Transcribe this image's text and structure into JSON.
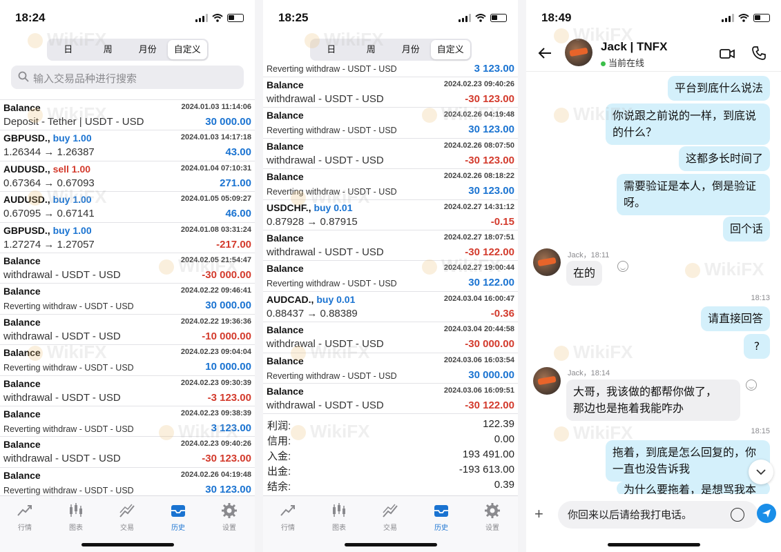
{
  "watermark": "WikiFX",
  "accent": "#1a73d1",
  "negative_color": "#d33a2c",
  "left": {
    "time": "18:24",
    "segments": [
      "日",
      "周",
      "月份",
      "自定义"
    ],
    "active_segment": "自定义",
    "search_placeholder": "输入交易品种进行搜索",
    "rows": [
      {
        "sym": "Balance",
        "side": "",
        "side_type": "",
        "dt": "2024.01.03 11:14:06",
        "cmt": "Deposit - Tether | USDT - USD",
        "small": false,
        "amt": "30 000.00",
        "sign": "pos"
      },
      {
        "sym": "GBPUSD.,",
        "side": "buy 1.00",
        "side_type": "buy",
        "dt": "2024.01.03 14:17:18",
        "cmt": "1.26344 → 1.26387",
        "small": false,
        "amt": "43.00",
        "sign": "pos"
      },
      {
        "sym": "AUDUSD.,",
        "side": "sell 1.00",
        "side_type": "sell",
        "dt": "2024.01.04 07:10:31",
        "cmt": "0.67364 → 0.67093",
        "small": false,
        "amt": "271.00",
        "sign": "pos"
      },
      {
        "sym": "AUDUSD.,",
        "side": "buy 1.00",
        "side_type": "buy",
        "dt": "2024.01.05 05:09:27",
        "cmt": "0.67095 → 0.67141",
        "small": false,
        "amt": "46.00",
        "sign": "pos"
      },
      {
        "sym": "GBPUSD.,",
        "side": "buy 1.00",
        "side_type": "buy",
        "dt": "2024.01.08 03:31:24",
        "cmt": "1.27274 → 1.27057",
        "small": false,
        "amt": "-217.00",
        "sign": "neg"
      },
      {
        "sym": "Balance",
        "side": "",
        "side_type": "",
        "dt": "2024.02.05 21:54:47",
        "cmt": "withdrawal - USDT - USD",
        "small": false,
        "amt": "-30 000.00",
        "sign": "neg"
      },
      {
        "sym": "Balance",
        "side": "",
        "side_type": "",
        "dt": "2024.02.22 09:46:41",
        "cmt": "Reverting withdraw - USDT - USD",
        "small": true,
        "amt": "30 000.00",
        "sign": "pos"
      },
      {
        "sym": "Balance",
        "side": "",
        "side_type": "",
        "dt": "2024.02.22 19:36:36",
        "cmt": "withdrawal - USDT - USD",
        "small": false,
        "amt": "-10 000.00",
        "sign": "neg"
      },
      {
        "sym": "Balance",
        "side": "",
        "side_type": "",
        "dt": "2024.02.23 09:04:04",
        "cmt": "Reverting withdraw - USDT - USD",
        "small": true,
        "amt": "10 000.00",
        "sign": "pos"
      },
      {
        "sym": "Balance",
        "side": "",
        "side_type": "",
        "dt": "2024.02.23 09:30:39",
        "cmt": "withdrawal - USDT - USD",
        "small": false,
        "amt": "-3 123.00",
        "sign": "neg"
      },
      {
        "sym": "Balance",
        "side": "",
        "side_type": "",
        "dt": "2024.02.23 09:38:39",
        "cmt": "Reverting withdraw - USDT - USD",
        "small": true,
        "amt": "3 123.00",
        "sign": "pos"
      },
      {
        "sym": "Balance",
        "side": "",
        "side_type": "",
        "dt": "2024.02.23 09:40:26",
        "cmt": "withdrawal - USDT - USD",
        "small": false,
        "amt": "-30 123.00",
        "sign": "neg"
      },
      {
        "sym": "Balance",
        "side": "",
        "side_type": "",
        "dt": "2024.02.26 04:19:48",
        "cmt": "Reverting withdraw - USDT - USD",
        "small": true,
        "amt": "30 123.00",
        "sign": "pos"
      }
    ],
    "tabs": [
      {
        "label": "行情",
        "icon": "quotes-icon"
      },
      {
        "label": "图表",
        "icon": "chart-icon"
      },
      {
        "label": "交易",
        "icon": "trade-icon"
      },
      {
        "label": "历史",
        "icon": "history-icon"
      },
      {
        "label": "设置",
        "icon": "settings-icon"
      }
    ],
    "active_tab": "历史"
  },
  "middle": {
    "time": "18:25",
    "segments": [
      "日",
      "周",
      "月份",
      "自定义"
    ],
    "active_segment": "自定义",
    "top_partial": {
      "cmt": "Reverting withdraw - USDT - USD",
      "amt": "3 123.00"
    },
    "rows": [
      {
        "sym": "Balance",
        "side": "",
        "side_type": "",
        "dt": "2024.02.23 09:40:26",
        "cmt": "withdrawal - USDT - USD",
        "small": false,
        "amt": "-30 123.00",
        "sign": "neg"
      },
      {
        "sym": "Balance",
        "side": "",
        "side_type": "",
        "dt": "2024.02.26 04:19:48",
        "cmt": "Reverting withdraw - USDT - USD",
        "small": true,
        "amt": "30 123.00",
        "sign": "pos"
      },
      {
        "sym": "Balance",
        "side": "",
        "side_type": "",
        "dt": "2024.02.26 08:07:50",
        "cmt": "withdrawal - USDT - USD",
        "small": false,
        "amt": "-30 123.00",
        "sign": "neg"
      },
      {
        "sym": "Balance",
        "side": "",
        "side_type": "",
        "dt": "2024.02.26 08:18:22",
        "cmt": "Reverting withdraw - USDT - USD",
        "small": true,
        "amt": "30 123.00",
        "sign": "pos"
      },
      {
        "sym": "USDCHF.,",
        "side": "buy 0.01",
        "side_type": "buy",
        "dt": "2024.02.27 14:31:12",
        "cmt": "0.87928 → 0.87915",
        "small": false,
        "amt": "-0.15",
        "sign": "neg"
      },
      {
        "sym": "Balance",
        "side": "",
        "side_type": "",
        "dt": "2024.02.27 18:07:51",
        "cmt": "withdrawal - USDT - USD",
        "small": false,
        "amt": "-30 122.00",
        "sign": "neg"
      },
      {
        "sym": "Balance",
        "side": "",
        "side_type": "",
        "dt": "2024.02.27 19:00:44",
        "cmt": "Reverting withdraw - USDT - USD",
        "small": true,
        "amt": "30 122.00",
        "sign": "pos"
      },
      {
        "sym": "AUDCAD.,",
        "side": "buy 0.01",
        "side_type": "buy",
        "dt": "2024.03.04 16:00:47",
        "cmt": "0.88437 → 0.88389",
        "small": false,
        "amt": "-0.36",
        "sign": "neg"
      },
      {
        "sym": "Balance",
        "side": "",
        "side_type": "",
        "dt": "2024.03.04 20:44:58",
        "cmt": "withdrawal - USDT - USD",
        "small": false,
        "amt": "-30 000.00",
        "sign": "neg"
      },
      {
        "sym": "Balance",
        "side": "",
        "side_type": "",
        "dt": "2024.03.06 16:03:54",
        "cmt": "Reverting withdraw - USDT - USD",
        "small": true,
        "amt": "30 000.00",
        "sign": "pos"
      },
      {
        "sym": "Balance",
        "side": "",
        "side_type": "",
        "dt": "2024.03.06 16:09:51",
        "cmt": "withdrawal - USDT - USD",
        "small": false,
        "amt": "-30 122.00",
        "sign": "neg"
      }
    ],
    "totals": [
      {
        "label": "利润:",
        "value": "122.39"
      },
      {
        "label": "信用:",
        "value": "0.00"
      },
      {
        "label": "入金:",
        "value": "193 491.00"
      },
      {
        "label": "出金:",
        "value": "-193 613.00"
      },
      {
        "label": "结余:",
        "value": "0.39"
      }
    ],
    "tabs": [
      {
        "label": "行情",
        "icon": "quotes-icon"
      },
      {
        "label": "图表",
        "icon": "chart-icon"
      },
      {
        "label": "交易",
        "icon": "trade-icon"
      },
      {
        "label": "历史",
        "icon": "history-icon"
      },
      {
        "label": "设置",
        "icon": "settings-icon"
      }
    ],
    "active_tab": "历史"
  },
  "right": {
    "time": "18:49",
    "contact_name": "Jack | TNFX",
    "status": "当前在线",
    "messages": {
      "m1": "平台到底什么说法",
      "m2a": "你说跟之前说的一样，到底说",
      "m2b": "的什么？",
      "m3": "这都多长时间了",
      "m4a": "需要验证是本人，倒是验证",
      "m4b": "呀。",
      "m5": "回个话",
      "meta1": "Jack，18:11",
      "m6": "在的",
      "ts1": "18:13",
      "m7": "请直接回答",
      "m8": "?",
      "meta2": "Jack，18:14",
      "m9a": "大哥，我该做的都帮你做了，",
      "m9b": "那边也是拖着我能咋办",
      "ts2": "18:15",
      "m10a": "拖着，到底是怎么回复的，你",
      "m10b": "一直也没告诉我",
      "m11": "为什么要拖着，是想骂我本"
    },
    "input_text": "你回来以后请给我打电话。"
  }
}
